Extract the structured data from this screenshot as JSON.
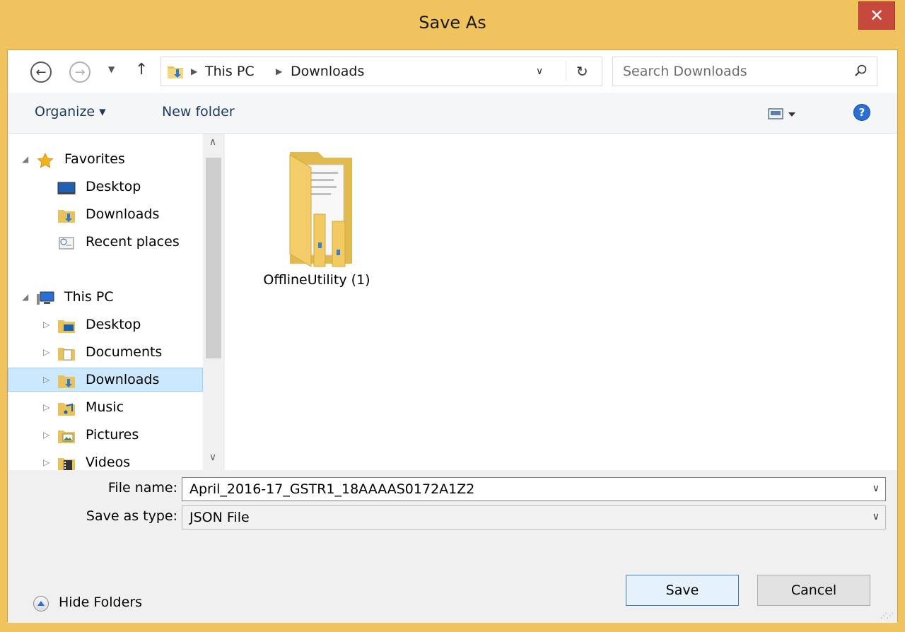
{
  "window": {
    "title": "Save As",
    "close_glyph": "✕"
  },
  "nav": {
    "back_icon": "back-arrow-icon",
    "forward_icon": "forward-arrow-icon",
    "up_icon": "up-arrow-icon",
    "breadcrumbs": [
      "This PC",
      "Downloads"
    ],
    "search_placeholder": "Search Downloads"
  },
  "toolbar": {
    "organize_label": "Organize ▾",
    "new_folder_label": "New folder"
  },
  "navpane": {
    "favorites": {
      "label": "Favorites",
      "items": [
        "Desktop",
        "Downloads",
        "Recent places"
      ]
    },
    "this_pc": {
      "label": "This PC",
      "items": [
        "Desktop",
        "Documents",
        "Downloads",
        "Music",
        "Pictures",
        "Videos"
      ]
    },
    "selected": "Downloads"
  },
  "content": {
    "items": [
      {
        "name": "OfflineUtility (1)",
        "type": "folder"
      }
    ]
  },
  "form": {
    "filename_label": "File name:",
    "filename_value": "April_2016-17_GSTR1_18AAAAS0172A1Z2",
    "type_label": "Save as type:",
    "type_value": "JSON File",
    "hide_folders_label": "Hide Folders",
    "save_label": "Save",
    "cancel_label": "Cancel"
  },
  "colors": {
    "title_bar": "#f0c35e",
    "close_button": "#c7483d",
    "selection": "#cce8ff",
    "link_text": "#1e395b"
  }
}
